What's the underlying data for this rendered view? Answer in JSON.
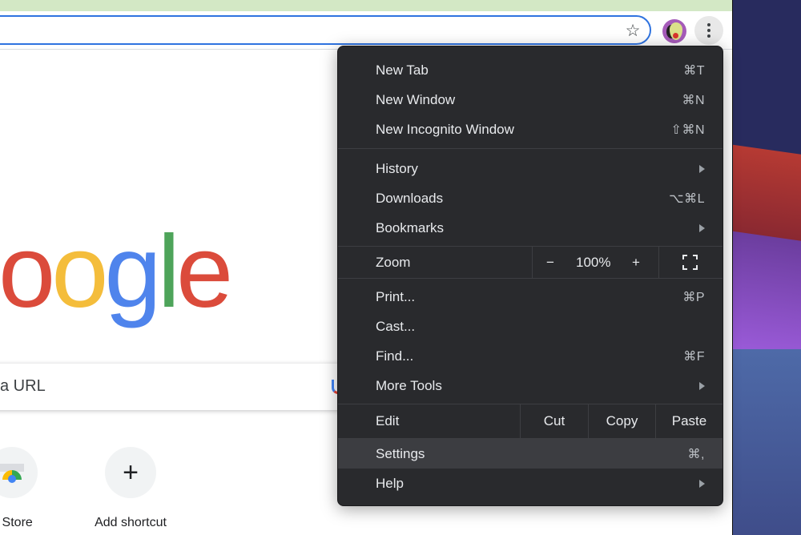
{
  "browser": {
    "toolbar": {
      "bookmark_icon": "star-outline",
      "profile_icon": "avocado-avatar",
      "menu_icon": "three-dots-vertical"
    }
  },
  "new_tab_page": {
    "logo_text": [
      "o",
      "o",
      "g",
      "l",
      "e"
    ],
    "logo_colors": [
      "#db4b3b",
      "#f4bd3b",
      "#4f84ec",
      "#4ea45a",
      "#db4b3b"
    ],
    "search_placeholder_visible": "a URL",
    "shortcuts": [
      {
        "label": "b Store",
        "icon": "web-store-icon"
      },
      {
        "label": "Add shortcut",
        "icon": "plus-icon",
        "glyph": "+"
      }
    ]
  },
  "menu": {
    "group1": [
      {
        "label": "New Tab",
        "shortcut": "⌘T"
      },
      {
        "label": "New Window",
        "shortcut": "⌘N"
      },
      {
        "label": "New Incognito Window",
        "shortcut": "⇧⌘N"
      }
    ],
    "group2": [
      {
        "label": "History",
        "submenu": true
      },
      {
        "label": "Downloads",
        "shortcut": "⌥⌘L"
      },
      {
        "label": "Bookmarks",
        "submenu": true
      }
    ],
    "zoom": {
      "label": "Zoom",
      "decrease": "−",
      "value": "100%",
      "increase": "+",
      "fullscreen_icon": "fullscreen-icon"
    },
    "group3": [
      {
        "label": "Print...",
        "shortcut": "⌘P"
      },
      {
        "label": "Cast..."
      },
      {
        "label": "Find...",
        "shortcut": "⌘F"
      },
      {
        "label": "More Tools",
        "submenu": true
      }
    ],
    "edit": {
      "label": "Edit",
      "cut": "Cut",
      "copy": "Copy",
      "paste": "Paste"
    },
    "group4": [
      {
        "label": "Settings",
        "shortcut": "⌘,",
        "highlighted": true
      },
      {
        "label": "Help",
        "submenu": true
      }
    ]
  }
}
